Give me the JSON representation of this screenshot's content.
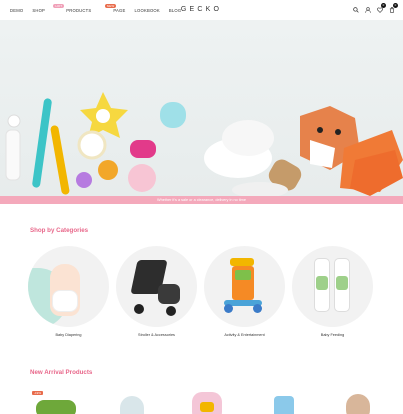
{
  "header": {
    "nav": [
      {
        "label": "DEMO"
      },
      {
        "label": "SHOP",
        "badge": "HOT",
        "badge_color": "#f0a0b8"
      },
      {
        "label": "PRODUCTS",
        "badge": "NEW",
        "badge_color": "#e86b4b"
      },
      {
        "label": "PAGE"
      },
      {
        "label": "LOOKBOOK"
      },
      {
        "label": "BLOG"
      }
    ],
    "logo": "GECKO",
    "wishlist_count": "0",
    "cart_count": "0"
  },
  "hero": {
    "promo_text": "Whether it's a sale or a clearance, delivery in no time"
  },
  "categories": {
    "title": "Shop by Categories",
    "items": [
      {
        "label": "Baby Diapering"
      },
      {
        "label": "Stroller & Accessories"
      },
      {
        "label": "Activity & Entertainment"
      },
      {
        "label": "Baby Feeding"
      }
    ]
  },
  "arrivals": {
    "title": "New Arrival Products",
    "sale_badge": "-19%"
  },
  "colors": {
    "accent": "#e8678a",
    "promo_bg": "#f4a9bb"
  }
}
